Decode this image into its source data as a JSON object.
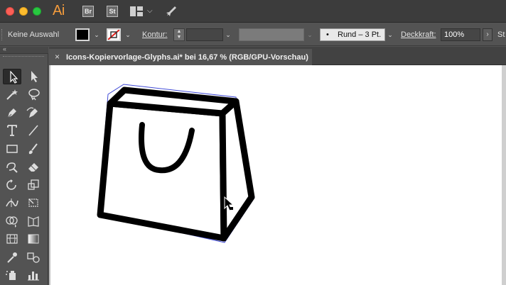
{
  "app": {
    "logo": "Ai",
    "bridge_label": "Br",
    "stock_label": "St"
  },
  "control_bar": {
    "selection_status": "Keine Auswahl",
    "stroke_label": "Kontur:",
    "stroke_weight_value": "",
    "brush_profile": "Rund – 3 Pt.",
    "opacity_label": "Deckkraft:",
    "opacity_value": "100%",
    "style_label": "St"
  },
  "tools_panel": {
    "collapse_label": "«"
  },
  "document": {
    "tab_title": "Icons-Kopiervorlage-Glyphs.ai* bei 16,67 % (RGB/GPU-Vorschau)",
    "close_label": "×"
  },
  "colors": {
    "fill": "#000000",
    "stroke": "none",
    "selection_outline": "#3f49d6"
  }
}
